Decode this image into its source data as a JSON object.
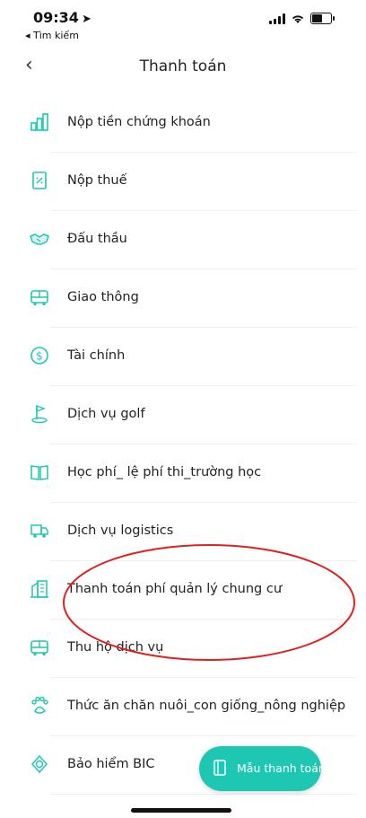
{
  "status_bar": {
    "time": "09:34",
    "back_app": "◂ Tìm kiếm"
  },
  "nav": {
    "title": "Thanh toán"
  },
  "items": [
    {
      "label": "Nộp tiền chứng khoán",
      "icon": "chart-icon"
    },
    {
      "label": "Nộp thuế",
      "icon": "tax-document-icon"
    },
    {
      "label": "Đấu thầu",
      "icon": "handshake-icon"
    },
    {
      "label": "Giao thông",
      "icon": "bus-icon"
    },
    {
      "label": "Tài chính",
      "icon": "dollar-icon"
    },
    {
      "label": "Dịch vụ golf",
      "icon": "golf-icon"
    },
    {
      "label": "Học phí_ lệ phí thi_trường học",
      "icon": "book-icon"
    },
    {
      "label": "Dịch vụ logistics",
      "icon": "truck-icon"
    },
    {
      "label": "Thanh toán phí quản lý chung cư",
      "icon": "building-icon"
    },
    {
      "label": "Thu hộ dịch vụ",
      "icon": "bus-icon"
    },
    {
      "label": "Thức ăn chăn nuôi_con giống_nông nghiệp",
      "icon": "paw-icon"
    },
    {
      "label": "Bảo hiểm BIC",
      "icon": "shield-icon"
    }
  ],
  "fab": {
    "label": "Mẫu thanh toán"
  },
  "colors": {
    "accent": "#1ec7b2",
    "annotation": "#e02020"
  }
}
